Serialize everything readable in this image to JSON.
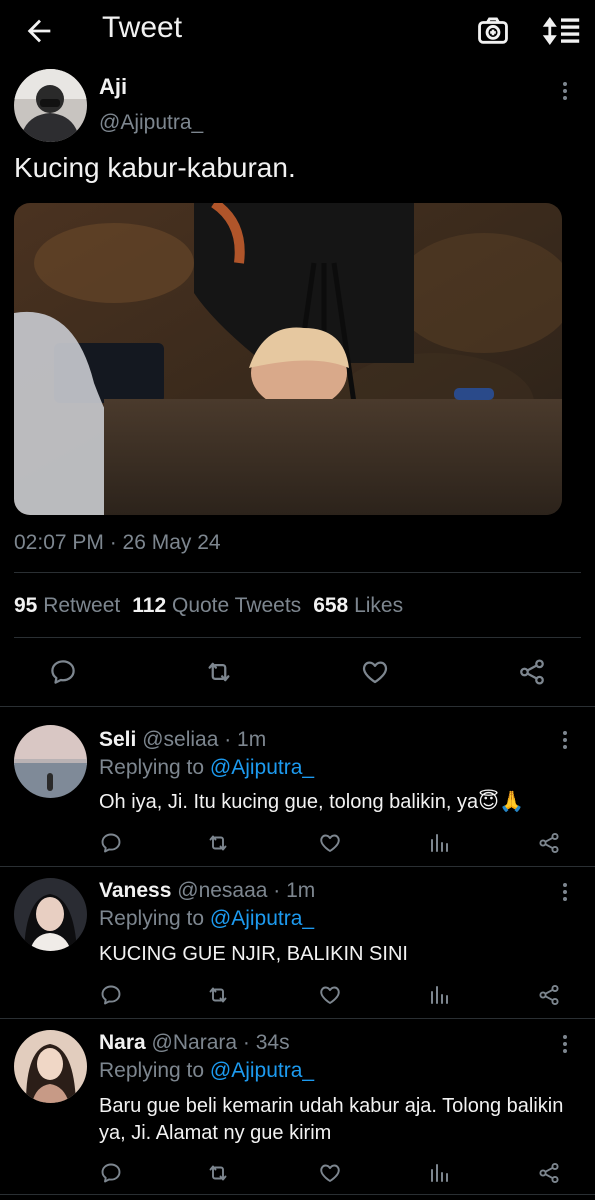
{
  "header": {
    "title": "Tweet"
  },
  "tweet": {
    "author_name": "Aji",
    "author_handle": "@Ajiputra_",
    "text": "Kucing kabur-kaburan.",
    "timestamp": "02:07 PM · 26 May 24",
    "stats": {
      "retweets_count": "95",
      "retweets_label": "Retweet",
      "quotes_count": "112",
      "quotes_label": "Quote Tweets",
      "likes_count": "658",
      "likes_label": "Likes"
    }
  },
  "replies": [
    {
      "name": "Seli",
      "handle_time": "@seliaa · 1m",
      "replying_prefix": "Replying to",
      "replying_handle": "@Ajiputra_",
      "text": "Oh iya, Ji. Itu kucing gue, tolong balikin, ya😇🙏"
    },
    {
      "name": "Vaness",
      "handle_time": "@nesaaa · 1m",
      "replying_prefix": "Replying to",
      "replying_handle": "@Ajiputra_",
      "text": "KUCING GUE NJIR, BALIKIN SINI"
    },
    {
      "name": "Nara",
      "handle_time": "@Narara · 34s",
      "replying_prefix": "Replying to",
      "replying_handle": "@Ajiputra_",
      "text": "Baru gue beli kemarin udah kabur aja. Tolong balikin ya, Ji. Alamat ny gue kirim"
    }
  ],
  "colors": {
    "background": "#000000",
    "text": "#f2f2f2",
    "muted": "#7d868f",
    "link": "#1d9bf0",
    "divider": "#2a2f33"
  },
  "icons": {
    "back": "arrow-left-icon",
    "camera": "camera-plus-icon",
    "sort": "sort-icon",
    "more": "more-vertical-icon",
    "reply": "reply-icon",
    "retweet": "retweet-icon",
    "like": "heart-icon",
    "share": "share-icon",
    "analytics": "analytics-icon"
  }
}
